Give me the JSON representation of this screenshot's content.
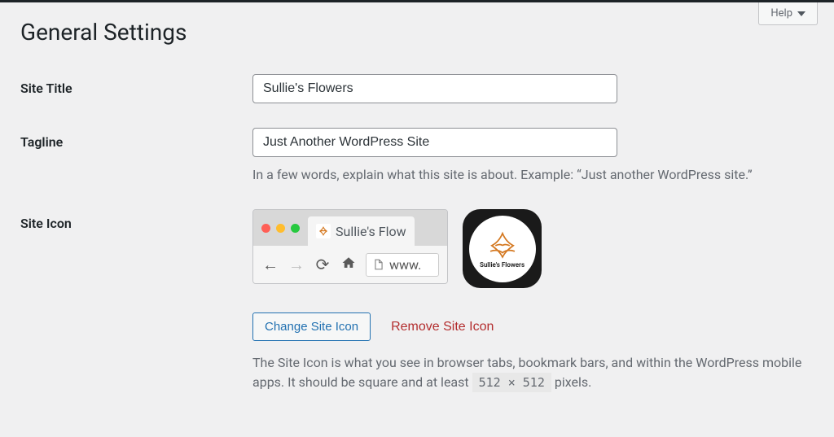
{
  "help": {
    "label": "Help"
  },
  "page": {
    "title": "General Settings"
  },
  "fields": {
    "site_title": {
      "label": "Site Title",
      "value": "Sullie's Flowers"
    },
    "tagline": {
      "label": "Tagline",
      "value": "Just Another WordPress Site",
      "description": "In a few words, explain what this site is about. Example: “Just another WordPress site.”"
    },
    "site_icon": {
      "label": "Site Icon",
      "tab_title": "Sullie's Flow",
      "url_text": "www.",
      "brand_text": "Sullie's Flowers",
      "change_button": "Change Site Icon",
      "remove_button": "Remove Site Icon",
      "description_before": "The Site Icon is what you see in browser tabs, bookmark bars, and within the WordPress mobile apps. It should be square and at least ",
      "description_size": "512 × 512",
      "description_after": " pixels."
    }
  }
}
